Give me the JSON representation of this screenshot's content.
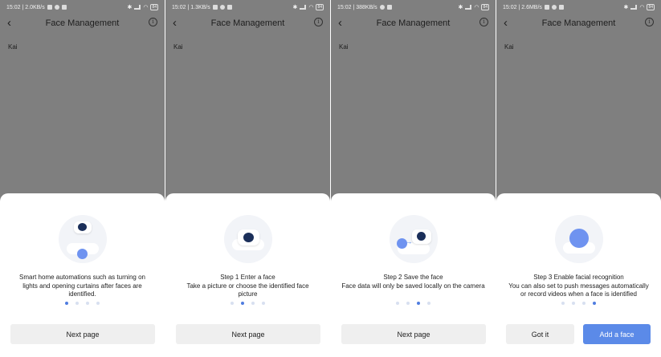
{
  "colors": {
    "overlay": "#7f7f7f",
    "sheet": "#ffffff",
    "accent": "#4f7de0",
    "primary_button": "#5b8ae8",
    "secondary_button": "#efefef",
    "face_icon": "#6f93f0",
    "dot_inactive": "#d8e0f0"
  },
  "screens": [
    {
      "status": {
        "time_speed": "15:02 | 2.0KB/s",
        "battery": "84"
      },
      "header": {
        "title": "Face Management",
        "back_icon": "chevron-left",
        "info_icon": "info-circle"
      },
      "device_name": "Kai",
      "sheet": {
        "illustration": "camera-with-face",
        "text_lines": [
          "Smart home automations such as turning on",
          "lights and opening curtains after faces are",
          "identified."
        ],
        "active_page": 1,
        "page_count": 4,
        "buttons": [
          {
            "label": "Next page",
            "style": "secondary"
          }
        ]
      }
    },
    {
      "status": {
        "time_speed": "15:02 | 1.3KB/s",
        "battery": "84"
      },
      "header": {
        "title": "Face Management",
        "back_icon": "chevron-left",
        "info_icon": "info-circle"
      },
      "device_name": "Kai",
      "sheet": {
        "illustration": "camera-capture",
        "text_lines": [
          "Step 1 Enter a face",
          "Take a picture or choose the identified face",
          "picture"
        ],
        "active_page": 2,
        "page_count": 4,
        "buttons": [
          {
            "label": "Next page",
            "style": "secondary"
          }
        ]
      }
    },
    {
      "status": {
        "time_speed": "15:02 | 388KB/s",
        "battery": "84"
      },
      "header": {
        "title": "Face Management",
        "back_icon": "chevron-left",
        "info_icon": "info-circle"
      },
      "device_name": "Kai",
      "sheet": {
        "illustration": "face-to-camera",
        "text_lines": [
          "Step 2 Save the face",
          "Face data will only be saved locally on the camera"
        ],
        "active_page": 3,
        "page_count": 4,
        "buttons": [
          {
            "label": "Next page",
            "style": "secondary"
          }
        ]
      }
    },
    {
      "status": {
        "time_speed": "15:02 | 2.6MB/s",
        "battery": "84"
      },
      "header": {
        "title": "Face Management",
        "back_icon": "chevron-left",
        "info_icon": "info-circle"
      },
      "device_name": "Kai",
      "sheet": {
        "illustration": "face-recognition",
        "text_lines": [
          "Step 3 Enable facial recognition",
          "You can also set to push messages automatically",
          "or record videos when a face is identified"
        ],
        "active_page": 4,
        "page_count": 4,
        "buttons": [
          {
            "label": "Got it",
            "style": "secondary"
          },
          {
            "label": "Add a face",
            "style": "primary"
          }
        ]
      }
    }
  ]
}
